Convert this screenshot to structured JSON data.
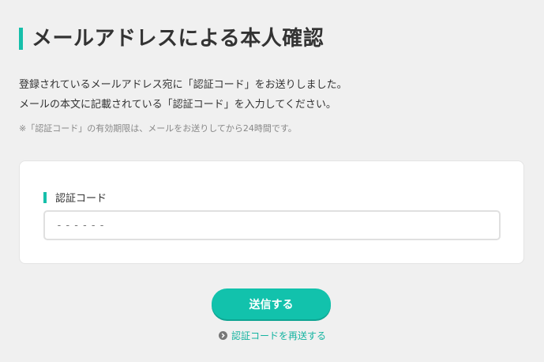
{
  "header": {
    "title": "メールアドレスによる本人確認"
  },
  "description": {
    "line1": "登録されているメールアドレス宛に「認証コード」をお送りしました。",
    "line2": "メールの本文に記載されている「認証コード」を入力してください。",
    "note": "※「認証コード」の有効期限は、メールをお送りしてから24時間です。"
  },
  "form": {
    "code_label": "認証コード",
    "code_placeholder": "------",
    "code_value": ""
  },
  "actions": {
    "submit_label": "送信する",
    "resend_label": "認証コードを再送する"
  },
  "colors": {
    "accent": "#12c2ac",
    "background": "#f0f0f0",
    "link": "#16b4a1"
  },
  "icons": {
    "resend": "chevron-right-circle-icon"
  }
}
